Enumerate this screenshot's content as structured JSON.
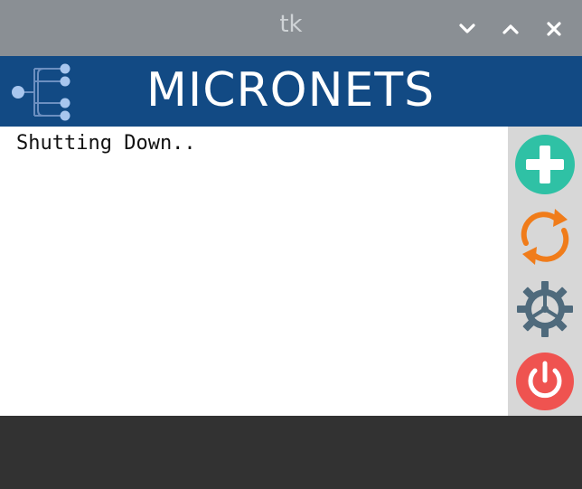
{
  "window": {
    "title": "tk",
    "controls": {
      "minimize_icon": "chevron-down-icon",
      "maximize_icon": "chevron-up-icon",
      "close_icon": "close-icon"
    }
  },
  "banner": {
    "title": "MICRONETS",
    "logo_icon": "network-tree-icon",
    "background": "#124a84"
  },
  "content": {
    "status": "Shutting Down.."
  },
  "sidebar": {
    "buttons": [
      {
        "name": "add",
        "icon": "plus-circle-icon",
        "color": "#2fc1a5"
      },
      {
        "name": "refresh",
        "icon": "refresh-icon",
        "color": "#f07c1a"
      },
      {
        "name": "settings",
        "icon": "gear-icon",
        "color": "#4f6a7c"
      },
      {
        "name": "power",
        "icon": "power-icon",
        "color": "#ef5350"
      }
    ]
  }
}
